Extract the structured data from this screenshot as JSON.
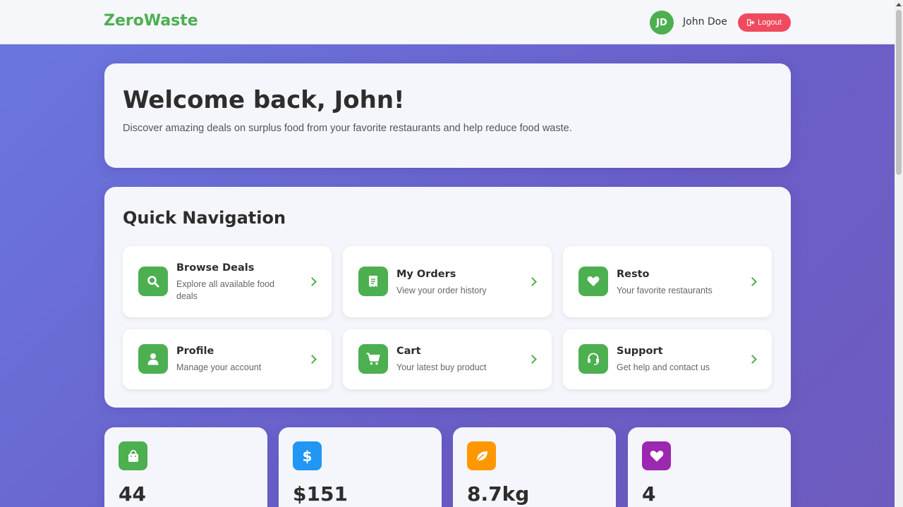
{
  "header": {
    "brand": "ZeroWaste",
    "avatar_initials": "JD",
    "username": "John Doe",
    "logout_label": "Logout",
    "brand_color": "#4caf50",
    "logout_color": "#f04a5e"
  },
  "welcome": {
    "title": "Welcome back, John!",
    "subtitle": "Discover amazing deals on surplus food from your favorite restaurants and help reduce food waste."
  },
  "quick_nav": {
    "title": "Quick Navigation",
    "items": [
      {
        "title": "Browse Deals",
        "desc": "Explore all available food deals",
        "icon": "search-icon"
      },
      {
        "title": "My Orders",
        "desc": "View your order history",
        "icon": "receipt-icon"
      },
      {
        "title": "Resto",
        "desc": "Your favorite restaurants",
        "icon": "heart-icon"
      },
      {
        "title": "Profile",
        "desc": "Manage your account",
        "icon": "user-icon"
      },
      {
        "title": "Cart",
        "desc": "Your latest buy product",
        "icon": "cart-icon"
      },
      {
        "title": "Support",
        "desc": "Get help and contact us",
        "icon": "headset-icon"
      }
    ]
  },
  "stats": [
    {
      "value": "44",
      "icon": "shopping-bag-icon",
      "color": "#4caf50"
    },
    {
      "value": "$151",
      "icon": "dollar-icon",
      "color": "#2196f3"
    },
    {
      "value": "8.7kg",
      "icon": "leaf-icon",
      "color": "#ff9800"
    },
    {
      "value": "4",
      "icon": "heart-icon",
      "color": "#9c27b0"
    }
  ]
}
